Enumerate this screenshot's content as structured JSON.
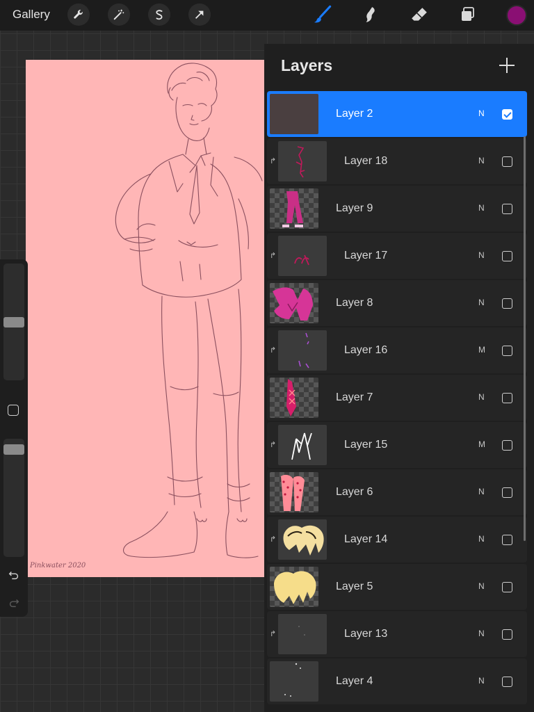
{
  "toolbar": {
    "gallery_label": "Gallery",
    "left_tools": [
      "wrench-icon",
      "magic-wand-icon",
      "selection-s-icon",
      "transform-arrow-icon"
    ],
    "right_tools": [
      "brush-icon",
      "smudge-icon",
      "eraser-icon",
      "layers-icon"
    ],
    "active_tool": "brush-icon",
    "active_color": "#8a0f73",
    "accent_color": "#1a7cff"
  },
  "canvas": {
    "background_color": "#ffb6b6",
    "line_color": "#8a4f5e",
    "signature": "Pinkwater 2020"
  },
  "layers_panel": {
    "title": "Layers",
    "add_icon": "plus-icon",
    "layers": [
      {
        "name": "Layer 2",
        "blend": "N",
        "visible": true,
        "selected": true,
        "clipped": false
      },
      {
        "name": "Layer 18",
        "blend": "N",
        "visible": false,
        "selected": false,
        "clipped": true
      },
      {
        "name": "Layer 9",
        "blend": "N",
        "visible": false,
        "selected": false,
        "clipped": false
      },
      {
        "name": "Layer 17",
        "blend": "N",
        "visible": false,
        "selected": false,
        "clipped": true
      },
      {
        "name": "Layer 8",
        "blend": "N",
        "visible": false,
        "selected": false,
        "clipped": false
      },
      {
        "name": "Layer 16",
        "blend": "M",
        "visible": false,
        "selected": false,
        "clipped": true
      },
      {
        "name": "Layer 7",
        "blend": "N",
        "visible": false,
        "selected": false,
        "clipped": false
      },
      {
        "name": "Layer 15",
        "blend": "M",
        "visible": false,
        "selected": false,
        "clipped": true
      },
      {
        "name": "Layer 6",
        "blend": "N",
        "visible": false,
        "selected": false,
        "clipped": false
      },
      {
        "name": "Layer 14",
        "blend": "N",
        "visible": false,
        "selected": false,
        "clipped": true
      },
      {
        "name": "Layer 5",
        "blend": "N",
        "visible": false,
        "selected": false,
        "clipped": false
      },
      {
        "name": "Layer 13",
        "blend": "N",
        "visible": false,
        "selected": false,
        "clipped": true
      },
      {
        "name": "Layer 4",
        "blend": "N",
        "visible": false,
        "selected": false,
        "clipped": false
      }
    ]
  },
  "sidebar": {
    "brush_size_level": 0.5,
    "opacity_level": 0.95,
    "modify_button_icon": "square-icon",
    "undo_icon": "undo-icon",
    "redo_icon": "redo-icon"
  }
}
